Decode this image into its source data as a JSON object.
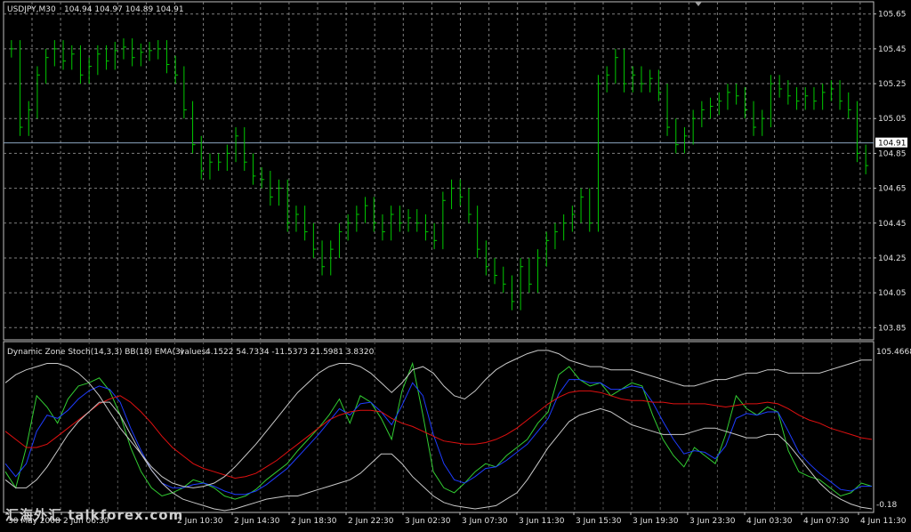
{
  "chart_data": [
    {
      "type": "bar",
      "style": "ohlc",
      "title": "USDJPY,M30",
      "ohlc_header": "104.94 104.97 104.89 104.91",
      "ylim": [
        103.78,
        105.72
      ],
      "y_ticks": [
        "105.65",
        "105.45",
        "105.25",
        "105.05",
        "104.85",
        "104.65",
        "104.45",
        "104.25",
        "104.05",
        "103.85"
      ],
      "y_tick_values": [
        105.65,
        105.45,
        105.25,
        105.05,
        104.85,
        104.65,
        104.45,
        104.25,
        104.05,
        103.85
      ],
      "current_price": 104.91,
      "current_price_label": "104.91",
      "grid": true,
      "colors": {
        "bars": "#00c800",
        "grid": "#7f7f7f",
        "current_line": "#8ca6c0",
        "axis": "#c0c0c0"
      },
      "closes": [
        105.45,
        105.0,
        105.1,
        105.3,
        105.4,
        105.45,
        105.38,
        105.42,
        105.3,
        105.35,
        105.42,
        105.38,
        105.44,
        105.46,
        105.4,
        105.43,
        105.44,
        105.45,
        105.36,
        105.3,
        105.1,
        104.9,
        104.75,
        104.8,
        104.8,
        104.85,
        104.95,
        104.8,
        104.72,
        104.7,
        104.6,
        104.65,
        104.45,
        104.5,
        104.4,
        104.3,
        104.2,
        104.3,
        104.4,
        104.45,
        104.5,
        104.55,
        104.45,
        104.4,
        104.5,
        104.45,
        104.48,
        104.45,
        104.4,
        104.35,
        104.58,
        104.65,
        104.6,
        104.5,
        104.3,
        104.2,
        104.15,
        104.1,
        104.0,
        104.2,
        104.1,
        104.25,
        104.35,
        104.4,
        104.45,
        104.5,
        104.6,
        104.45,
        105.25,
        105.3,
        105.4,
        105.25,
        105.3,
        105.25,
        105.28,
        105.2,
        105.0,
        104.9,
        104.95,
        105.05,
        105.1,
        105.12,
        105.15,
        105.2,
        105.18,
        105.1,
        105.0,
        105.05,
        105.25,
        105.22,
        105.18,
        105.15,
        105.18,
        105.15,
        105.2,
        105.22,
        105.15,
        105.1,
        104.85,
        104.78
      ]
    },
    {
      "type": "line",
      "title": "Dynamic Zone Stoch(14,3,3) BB(18) EMA(3)",
      "values_label": "values:",
      "values_text": "4.1522 54.7334 -11.5373 21.5981 3.8320",
      "ylim": [
        -0.18,
        105.4668
      ],
      "y_ticks": [
        "105.4668",
        "-0.18"
      ],
      "y_tick_values": [
        105.4668,
        -0.18
      ],
      "x_labels": [
        "30 May 2008",
        "2 Jun 06:30",
        "2 Jun 10:30",
        "2 Jun 14:30",
        "2 Jun 18:30",
        "2 Jun 22:30",
        "3 Jun 02:30",
        "3 Jun 07:30",
        "3 Jun 11:30",
        "3 Jun 15:30",
        "3 Jun 19:30",
        "3 Jun 23:30",
        "4 Jun 03:30",
        "4 Jun 07:30",
        "4 Jun 11:30"
      ],
      "colors": {
        "stoch": "#32cd32",
        "ema": "#1e3cff",
        "mid": "#e01010",
        "band": "#c8c8c8"
      },
      "series": [
        {
          "values": [
            25,
            15,
            40,
            72,
            65,
            55,
            70,
            78,
            80,
            83,
            75,
            60,
            40,
            25,
            15,
            10,
            12,
            15,
            20,
            18,
            15,
            10,
            8,
            10,
            14,
            20,
            25,
            30,
            38,
            45,
            52,
            60,
            70,
            55,
            72,
            68,
            58,
            45,
            75,
            92,
            60,
            25,
            15,
            12,
            18,
            25,
            30,
            28,
            35,
            40,
            45,
            55,
            62,
            85,
            90,
            82,
            78,
            80,
            72,
            76,
            80,
            78,
            60,
            45,
            35,
            28,
            40,
            35,
            30,
            48,
            72,
            64,
            60,
            65,
            62,
            38,
            25,
            22,
            20,
            15,
            10,
            12,
            18,
            16
          ]
        },
        {
          "values": [
            30,
            22,
            30,
            50,
            60,
            58,
            63,
            70,
            75,
            78,
            76,
            68,
            52,
            38,
            26,
            18,
            15,
            15,
            17,
            18,
            16,
            13,
            11,
            11,
            13,
            17,
            22,
            27,
            34,
            41,
            48,
            56,
            64,
            60,
            67,
            68,
            62,
            54,
            66,
            80,
            72,
            48,
            30,
            20,
            18,
            22,
            27,
            28,
            32,
            37,
            42,
            50,
            58,
            73,
            82,
            82,
            80,
            80,
            76,
            76,
            78,
            77,
            68,
            56,
            45,
            36,
            38,
            37,
            33,
            41,
            58,
            61,
            60,
            62,
            62,
            50,
            37,
            30,
            24,
            19,
            14,
            13,
            16,
            16
          ]
        },
        {
          "values": [
            50,
            45,
            40,
            40,
            42,
            47,
            52,
            57,
            62,
            67,
            70,
            72,
            68,
            62,
            55,
            47,
            40,
            35,
            30,
            27,
            25,
            23,
            21,
            22,
            24,
            28,
            32,
            37,
            42,
            47,
            52,
            57,
            60,
            62,
            63,
            63,
            62,
            58,
            55,
            53,
            50,
            47,
            44,
            43,
            42,
            42,
            43,
            45,
            48,
            52,
            57,
            62,
            67,
            71,
            74,
            75,
            75,
            74,
            72,
            70,
            69,
            69,
            68,
            68,
            67,
            67,
            67,
            67,
            66,
            65,
            66,
            67,
            67,
            68,
            67,
            64,
            60,
            57,
            55,
            52,
            50,
            48,
            46,
            45
          ]
        },
        {
          "values": [
            80,
            85,
            88,
            90,
            92,
            92,
            90,
            86,
            80,
            72,
            62,
            52,
            44,
            36,
            28,
            22,
            18,
            16,
            15,
            16,
            18,
            22,
            28,
            35,
            42,
            50,
            58,
            66,
            74,
            80,
            86,
            90,
            92,
            92,
            90,
            86,
            80,
            74,
            80,
            88,
            90,
            86,
            78,
            72,
            70,
            75,
            82,
            88,
            92,
            95,
            98,
            100,
            100,
            98,
            94,
            92,
            90,
            90,
            88,
            88,
            88,
            86,
            84,
            82,
            80,
            78,
            78,
            80,
            82,
            82,
            84,
            86,
            86,
            88,
            88,
            86,
            86,
            86,
            86,
            88,
            90,
            92,
            94,
            94
          ]
        },
        {
          "values": [
            20,
            15,
            15,
            20,
            28,
            38,
            48,
            56,
            62,
            68,
            68,
            60,
            48,
            36,
            26,
            18,
            12,
            8,
            6,
            4,
            2,
            1,
            2,
            4,
            6,
            8,
            9,
            10,
            10,
            12,
            14,
            16,
            18,
            20,
            24,
            30,
            36,
            36,
            30,
            22,
            16,
            10,
            6,
            4,
            3,
            2,
            3,
            4,
            8,
            12,
            20,
            30,
            40,
            48,
            56,
            60,
            62,
            64,
            62,
            58,
            54,
            52,
            50,
            48,
            48,
            48,
            50,
            52,
            52,
            50,
            48,
            46,
            46,
            48,
            48,
            42,
            34,
            26,
            18,
            12,
            8,
            5,
            3,
            2
          ]
        }
      ]
    }
  ],
  "watermark": "汇海外汇 talkforex.com"
}
